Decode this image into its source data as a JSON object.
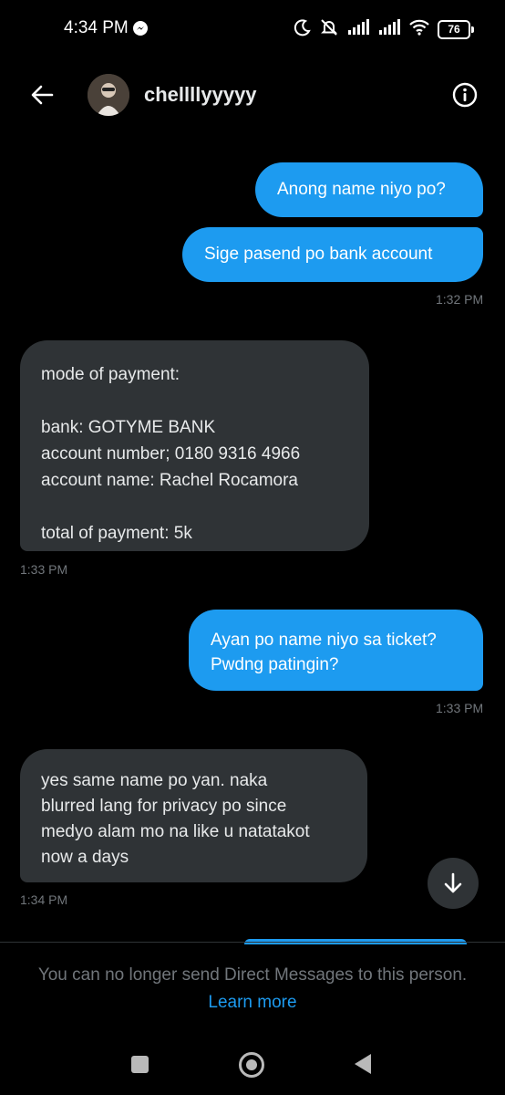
{
  "status_bar": {
    "time": "4:34 PM",
    "battery": "76"
  },
  "header": {
    "username": "chellllyyyyy"
  },
  "messages": [
    {
      "text": "Anong name niyo po?"
    },
    {
      "text": "Sige pasend po bank account",
      "time": "1:32 PM"
    },
    {
      "text": "mode of payment:\n\nbank: GOTYME BANK\naccount number; 0180 9316 4966\naccount name: Rachel Rocamora\n\ntotal of payment: 5k",
      "time": "1:33 PM"
    },
    {
      "text": "Ayan po name niyo sa ticket?\nPwdng patingin?",
      "time": "1:33 PM"
    },
    {
      "text": "yes same name po yan. naka\nblurred lang for privacy po since\nmedyo alam mo na like u natatakot\nnow a days",
      "time": "1:34 PM"
    }
  ],
  "footer": {
    "notice": "You can no longer send Direct Messages to this person.",
    "learn_more": "Learn more"
  },
  "colors": {
    "sent_bubble": "#1d9bf0",
    "received_bubble": "#2f3336",
    "background": "#000000",
    "link": "#1d9bf0"
  },
  "icons": [
    "messenger-icon",
    "moon-icon",
    "muted-bell-icon",
    "signal-icon",
    "wifi-icon",
    "battery-icon",
    "back-arrow-icon",
    "info-icon",
    "arrow-down-icon"
  ]
}
